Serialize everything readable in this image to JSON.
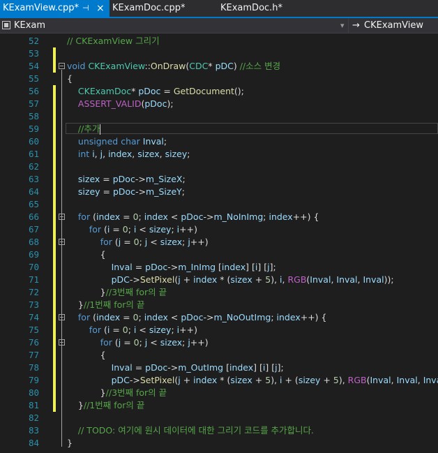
{
  "tabs": [
    {
      "label": "KExamView.cpp*",
      "pin_icon": "⊣",
      "close_icon": "×"
    },
    {
      "label": "KExamDoc.cpp*"
    },
    {
      "label": "KExamDoc.h*"
    }
  ],
  "navbar": {
    "class_scope": "KExam",
    "member_scope": "CKExamView",
    "arrow_icon": "→",
    "dropdown_icon": "▾"
  },
  "colors": {
    "tab_active_bg": "#007acc",
    "editor_bg": "#1e1e1e",
    "line_number": "#2b91af",
    "keyword": "#569cd6",
    "comment": "#57a64a",
    "type": "#4ec9b0",
    "function": "#dcdcaa",
    "variable": "#9cdcfe",
    "macro": "#bd63c5",
    "string_num": "#b5cea8",
    "changed_marker": "#efef57"
  },
  "code": [
    {
      "n": "52",
      "t": [
        [
          "c",
          "// CKExamView 그리기"
        ]
      ]
    },
    {
      "n": "53",
      "t": []
    },
    {
      "n": "54",
      "t": [
        [
          "k",
          "void "
        ],
        [
          "y",
          "CKExamView"
        ],
        [
          "p",
          "::"
        ],
        [
          "f",
          "OnDraw"
        ],
        [
          "p",
          "("
        ],
        [
          "y",
          "CDC"
        ],
        [
          "p",
          "* "
        ],
        [
          "v",
          "pDC"
        ],
        [
          "p",
          ") "
        ],
        [
          "c",
          "//소스 변경"
        ]
      ]
    },
    {
      "n": "55",
      "t": [
        [
          "p",
          "{"
        ]
      ]
    },
    {
      "n": "56",
      "t": [
        [
          "p",
          "    "
        ],
        [
          "y",
          "CKExamDoc"
        ],
        [
          "p",
          "* "
        ],
        [
          "v",
          "pDoc"
        ],
        [
          "p",
          " = "
        ],
        [
          "f",
          "GetDocument"
        ],
        [
          "p",
          "();"
        ]
      ]
    },
    {
      "n": "57",
      "t": [
        [
          "p",
          "    "
        ],
        [
          "m",
          "ASSERT_VALID"
        ],
        [
          "p",
          "("
        ],
        [
          "v",
          "pDoc"
        ],
        [
          "p",
          ");"
        ]
      ]
    },
    {
      "n": "58",
      "t": []
    },
    {
      "n": "59",
      "t": [
        [
          "p",
          "    "
        ],
        [
          "c",
          "//추가"
        ]
      ]
    },
    {
      "n": "60",
      "t": [
        [
          "p",
          "    "
        ],
        [
          "k",
          "unsigned char "
        ],
        [
          "v",
          "Inval"
        ],
        [
          "p",
          ";"
        ]
      ]
    },
    {
      "n": "61",
      "t": [
        [
          "p",
          "    "
        ],
        [
          "k",
          "int "
        ],
        [
          "v",
          "i"
        ],
        [
          "p",
          ", "
        ],
        [
          "v",
          "j"
        ],
        [
          "p",
          ", "
        ],
        [
          "v",
          "index"
        ],
        [
          "p",
          ", "
        ],
        [
          "v",
          "sizex"
        ],
        [
          "p",
          ", "
        ],
        [
          "v",
          "sizey"
        ],
        [
          "p",
          ";"
        ]
      ]
    },
    {
      "n": "62",
      "t": []
    },
    {
      "n": "63",
      "t": [
        [
          "p",
          "    "
        ],
        [
          "v",
          "sizex"
        ],
        [
          "p",
          " = "
        ],
        [
          "v",
          "pDoc"
        ],
        [
          "p",
          "->"
        ],
        [
          "v",
          "m_SizeX"
        ],
        [
          "p",
          ";"
        ]
      ]
    },
    {
      "n": "64",
      "t": [
        [
          "p",
          "    "
        ],
        [
          "v",
          "sizey"
        ],
        [
          "p",
          " = "
        ],
        [
          "v",
          "pDoc"
        ],
        [
          "p",
          "->"
        ],
        [
          "v",
          "m_SizeY"
        ],
        [
          "p",
          ";"
        ]
      ]
    },
    {
      "n": "65",
      "t": []
    },
    {
      "n": "66",
      "t": [
        [
          "p",
          "    "
        ],
        [
          "k",
          "for "
        ],
        [
          "p",
          "("
        ],
        [
          "v",
          "index"
        ],
        [
          "p",
          " = "
        ],
        [
          "n",
          "0"
        ],
        [
          "p",
          "; "
        ],
        [
          "v",
          "index"
        ],
        [
          "p",
          " < "
        ],
        [
          "v",
          "pDoc"
        ],
        [
          "p",
          "->"
        ],
        [
          "v",
          "m_NoInImg"
        ],
        [
          "p",
          "; "
        ],
        [
          "v",
          "index"
        ],
        [
          "p",
          "++) {"
        ]
      ]
    },
    {
      "n": "67",
      "t": [
        [
          "p",
          "        "
        ],
        [
          "k",
          "for "
        ],
        [
          "p",
          "("
        ],
        [
          "v",
          "i"
        ],
        [
          "p",
          " = "
        ],
        [
          "n",
          "0"
        ],
        [
          "p",
          "; "
        ],
        [
          "v",
          "i"
        ],
        [
          "p",
          " < "
        ],
        [
          "v",
          "sizey"
        ],
        [
          "p",
          "; "
        ],
        [
          "v",
          "i"
        ],
        [
          "p",
          "++)"
        ]
      ]
    },
    {
      "n": "68",
      "t": [
        [
          "p",
          "            "
        ],
        [
          "k",
          "for "
        ],
        [
          "p",
          "("
        ],
        [
          "v",
          "j"
        ],
        [
          "p",
          " = "
        ],
        [
          "n",
          "0"
        ],
        [
          "p",
          "; "
        ],
        [
          "v",
          "j"
        ],
        [
          "p",
          " < "
        ],
        [
          "v",
          "sizex"
        ],
        [
          "p",
          "; "
        ],
        [
          "v",
          "j"
        ],
        [
          "p",
          "++)"
        ]
      ]
    },
    {
      "n": "69",
      "t": [
        [
          "p",
          "            {"
        ]
      ]
    },
    {
      "n": "70",
      "t": [
        [
          "p",
          "                "
        ],
        [
          "v",
          "Inval"
        ],
        [
          "p",
          " = "
        ],
        [
          "v",
          "pDoc"
        ],
        [
          "p",
          "->"
        ],
        [
          "v",
          "m_InImg"
        ],
        [
          "p",
          " ["
        ],
        [
          "v",
          "index"
        ],
        [
          "p",
          "] ["
        ],
        [
          "v",
          "i"
        ],
        [
          "p",
          "] ["
        ],
        [
          "v",
          "j"
        ],
        [
          "p",
          "];"
        ]
      ]
    },
    {
      "n": "71",
      "t": [
        [
          "p",
          "                "
        ],
        [
          "v",
          "pDC"
        ],
        [
          "p",
          "->"
        ],
        [
          "f",
          "SetPixel"
        ],
        [
          "p",
          "("
        ],
        [
          "v",
          "j"
        ],
        [
          "p",
          " + "
        ],
        [
          "v",
          "index"
        ],
        [
          "p",
          " * ("
        ],
        [
          "v",
          "sizex"
        ],
        [
          "p",
          " + "
        ],
        [
          "n",
          "5"
        ],
        [
          "p",
          "), "
        ],
        [
          "v",
          "i"
        ],
        [
          "p",
          ", "
        ],
        [
          "m",
          "RGB"
        ],
        [
          "p",
          "("
        ],
        [
          "v",
          "Inval"
        ],
        [
          "p",
          ", "
        ],
        [
          "v",
          "Inval"
        ],
        [
          "p",
          ", "
        ],
        [
          "v",
          "Inval"
        ],
        [
          "p",
          "));"
        ]
      ]
    },
    {
      "n": "72",
      "t": [
        [
          "p",
          "            }"
        ],
        [
          "c",
          "//3번째 for의 끝"
        ]
      ]
    },
    {
      "n": "73",
      "t": [
        [
          "p",
          "    }"
        ],
        [
          "c",
          "//1번째 for의 끝"
        ]
      ]
    },
    {
      "n": "74",
      "t": [
        [
          "p",
          "    "
        ],
        [
          "k",
          "for "
        ],
        [
          "p",
          "("
        ],
        [
          "v",
          "index"
        ],
        [
          "p",
          " = "
        ],
        [
          "n",
          "0"
        ],
        [
          "p",
          "; "
        ],
        [
          "v",
          "index"
        ],
        [
          "p",
          " < "
        ],
        [
          "v",
          "pDoc"
        ],
        [
          "p",
          "->"
        ],
        [
          "v",
          "m_NoOutImg"
        ],
        [
          "p",
          "; "
        ],
        [
          "v",
          "index"
        ],
        [
          "p",
          "++) {"
        ]
      ]
    },
    {
      "n": "75",
      "t": [
        [
          "p",
          "        "
        ],
        [
          "k",
          "for "
        ],
        [
          "p",
          "("
        ],
        [
          "v",
          "i"
        ],
        [
          "p",
          " = "
        ],
        [
          "n",
          "0"
        ],
        [
          "p",
          "; "
        ],
        [
          "v",
          "i"
        ],
        [
          "p",
          " < "
        ],
        [
          "v",
          "sizey"
        ],
        [
          "p",
          "; "
        ],
        [
          "v",
          "i"
        ],
        [
          "p",
          "++)"
        ]
      ]
    },
    {
      "n": "76",
      "t": [
        [
          "p",
          "            "
        ],
        [
          "k",
          "for "
        ],
        [
          "p",
          "("
        ],
        [
          "v",
          "j"
        ],
        [
          "p",
          " = "
        ],
        [
          "n",
          "0"
        ],
        [
          "p",
          "; "
        ],
        [
          "v",
          "j"
        ],
        [
          "p",
          " < "
        ],
        [
          "v",
          "sizex"
        ],
        [
          "p",
          "; "
        ],
        [
          "v",
          "j"
        ],
        [
          "p",
          "++)"
        ]
      ]
    },
    {
      "n": "77",
      "t": [
        [
          "p",
          "            {"
        ]
      ]
    },
    {
      "n": "78",
      "t": [
        [
          "p",
          "                "
        ],
        [
          "v",
          "Inval"
        ],
        [
          "p",
          " = "
        ],
        [
          "v",
          "pDoc"
        ],
        [
          "p",
          "->"
        ],
        [
          "v",
          "m_OutImg"
        ],
        [
          "p",
          " ["
        ],
        [
          "v",
          "index"
        ],
        [
          "p",
          "] ["
        ],
        [
          "v",
          "i"
        ],
        [
          "p",
          "] ["
        ],
        [
          "v",
          "j"
        ],
        [
          "p",
          "];"
        ]
      ]
    },
    {
      "n": "79",
      "t": [
        [
          "p",
          "                "
        ],
        [
          "v",
          "pDC"
        ],
        [
          "p",
          "->"
        ],
        [
          "f",
          "SetPixel"
        ],
        [
          "p",
          "("
        ],
        [
          "v",
          "j"
        ],
        [
          "p",
          " + "
        ],
        [
          "v",
          "index"
        ],
        [
          "p",
          " * ("
        ],
        [
          "v",
          "sizex"
        ],
        [
          "p",
          " + "
        ],
        [
          "n",
          "5"
        ],
        [
          "p",
          "), "
        ],
        [
          "v",
          "i"
        ],
        [
          "p",
          " + ("
        ],
        [
          "v",
          "sizey"
        ],
        [
          "p",
          " + "
        ],
        [
          "n",
          "5"
        ],
        [
          "p",
          "), "
        ],
        [
          "m",
          "RGB"
        ],
        [
          "p",
          "("
        ],
        [
          "v",
          "Inval"
        ],
        [
          "p",
          ", "
        ],
        [
          "v",
          "Inval"
        ],
        [
          "p",
          ", "
        ],
        [
          "v",
          "Inval"
        ],
        [
          "p",
          "));"
        ]
      ]
    },
    {
      "n": "80",
      "t": [
        [
          "p",
          "            }"
        ],
        [
          "c",
          "//3번째 for의 끝"
        ]
      ]
    },
    {
      "n": "81",
      "t": [
        [
          "p",
          "    }"
        ],
        [
          "c",
          "//1번째 for의 끝"
        ]
      ]
    },
    {
      "n": "82",
      "t": []
    },
    {
      "n": "83",
      "t": [
        [
          "p",
          "    "
        ],
        [
          "c",
          "// TODO: 여기에 원시 데이터에 대한 그리기 코드를 추가합니다."
        ]
      ]
    },
    {
      "n": "84",
      "t": [
        [
          "p",
          "}"
        ]
      ]
    }
  ],
  "changed_lines": [
    "53",
    "54",
    "56",
    "57",
    "58",
    "59",
    "60",
    "61",
    "62",
    "63",
    "64",
    "65",
    "66",
    "67",
    "68",
    "69",
    "70",
    "71",
    "72",
    "73",
    "74",
    "75",
    "76",
    "77",
    "78",
    "79",
    "80",
    "81"
  ],
  "fold_lines": [
    "54",
    "66",
    "68",
    "74",
    "76"
  ],
  "current_line": "59"
}
